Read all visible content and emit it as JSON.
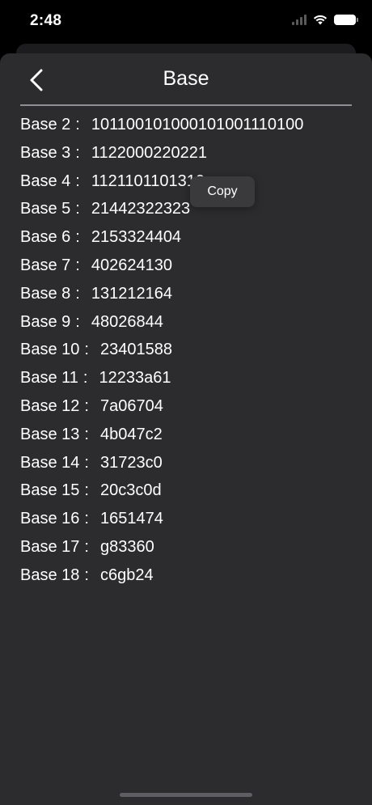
{
  "status_bar": {
    "time": "2:48",
    "icons": [
      "signal-icon",
      "wifi-icon",
      "battery-icon"
    ]
  },
  "nav": {
    "back_icon": "chevron-left-icon",
    "title": "Base"
  },
  "rows": [
    {
      "key": "Base 2",
      "value": "101100101000101001110100"
    },
    {
      "key": "Base 3",
      "value": "1122000220221"
    },
    {
      "key": "Base 4",
      "value": "1121101101310"
    },
    {
      "key": "Base 5",
      "value": "21442322323"
    },
    {
      "key": "Base 6",
      "value": "2153324404"
    },
    {
      "key": "Base 7",
      "value": "402624130"
    },
    {
      "key": "Base 8",
      "value": "131212164"
    },
    {
      "key": "Base 9",
      "value": "48026844"
    },
    {
      "key": "Base 10",
      "value": "23401588"
    },
    {
      "key": "Base 11",
      "value": "12233a61"
    },
    {
      "key": "Base 12",
      "value": "7a06704"
    },
    {
      "key": "Base 13",
      "value": "4b047c2"
    },
    {
      "key": "Base 14",
      "value": "31723c0"
    },
    {
      "key": "Base 15",
      "value": "20c3c0d"
    },
    {
      "key": "Base 16",
      "value": "1651474"
    },
    {
      "key": "Base 17",
      "value": "g83360"
    },
    {
      "key": "Base 18",
      "value": "c6gb24"
    }
  ],
  "separator": ":",
  "popup": {
    "label": "Copy"
  },
  "colors": {
    "background": "#000000",
    "sheet": "#2c2c2e",
    "popup": "#3a3a3c",
    "text": "#ffffff",
    "divider": "#8e8e93"
  }
}
